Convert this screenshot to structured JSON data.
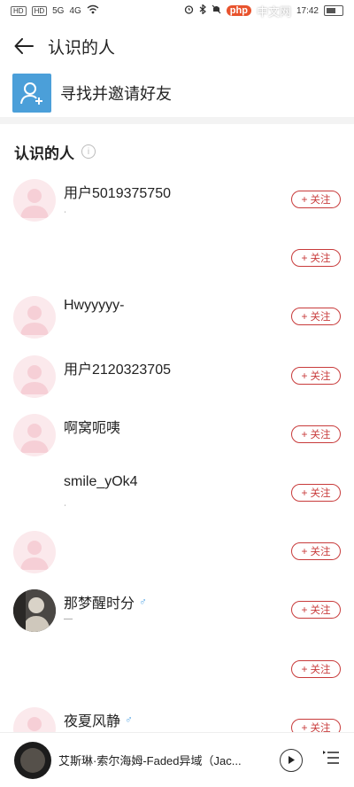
{
  "status_bar": {
    "left_chips": [
      "HD",
      "HD"
    ],
    "signal_a": "5G",
    "signal_b": "4G",
    "watermark_badge": "php",
    "watermark_text": "中文网",
    "time": "17:42"
  },
  "header": {
    "title": "认识的人"
  },
  "invite": {
    "label": "寻找并邀请好友"
  },
  "section": {
    "title": "认识的人",
    "info_glyph": "i"
  },
  "follow_label": "关注",
  "follow_plus": "+",
  "people": [
    {
      "name": "用户5019375750",
      "sub": "ˌ",
      "avatar": "placeholder",
      "male": false
    },
    {
      "name": "",
      "sub": "",
      "avatar": "blank",
      "male": false
    },
    {
      "name": "Hwyyyyy-",
      "sub": "",
      "avatar": "placeholder",
      "male": false
    },
    {
      "name": "用户2120323705",
      "sub": "",
      "avatar": "placeholder",
      "male": false
    },
    {
      "name": "啊窝呃咦",
      "sub": "",
      "avatar": "placeholder",
      "male": false
    },
    {
      "name": "smile_yOk4",
      "sub": "ˌ",
      "avatar": "blank",
      "male": false
    },
    {
      "name": "",
      "sub": "",
      "avatar": "placeholder",
      "male": false
    },
    {
      "name": "那梦醒时分",
      "sub": "—",
      "avatar": "photo",
      "male": true
    },
    {
      "name": "",
      "sub": "",
      "avatar": "blank",
      "male": false
    },
    {
      "name": "夜夏风静",
      "sub": "",
      "avatar": "placeholder",
      "male": true
    }
  ],
  "player": {
    "song": "艾斯琳·索尔海姆-Faded异域（Jac..."
  },
  "colors": {
    "accent": "#c83b3b",
    "invite_blue": "#4b9fd9",
    "avatar_pink": "#fbe9ec"
  }
}
